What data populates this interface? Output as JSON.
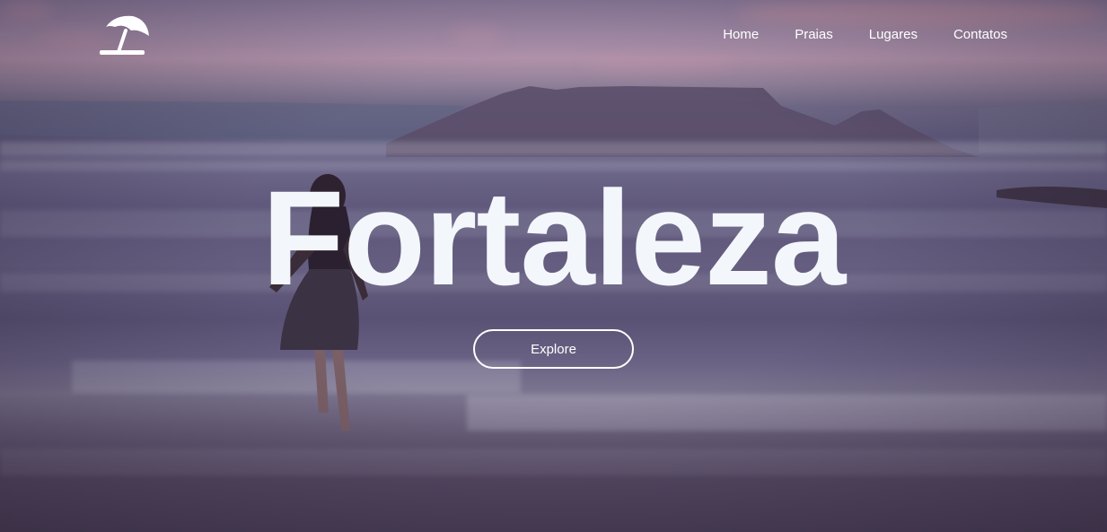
{
  "header": {
    "logo_icon": "beach-umbrella-icon",
    "nav": [
      {
        "label": "Home"
      },
      {
        "label": "Praias"
      },
      {
        "label": "Lugares"
      },
      {
        "label": "Contatos"
      }
    ]
  },
  "hero": {
    "title": "Fortaleza",
    "button_label": "Explore",
    "title_color": "#f3f6fb",
    "background_image": "beach-at-dusk-with-woman-in-waves"
  }
}
